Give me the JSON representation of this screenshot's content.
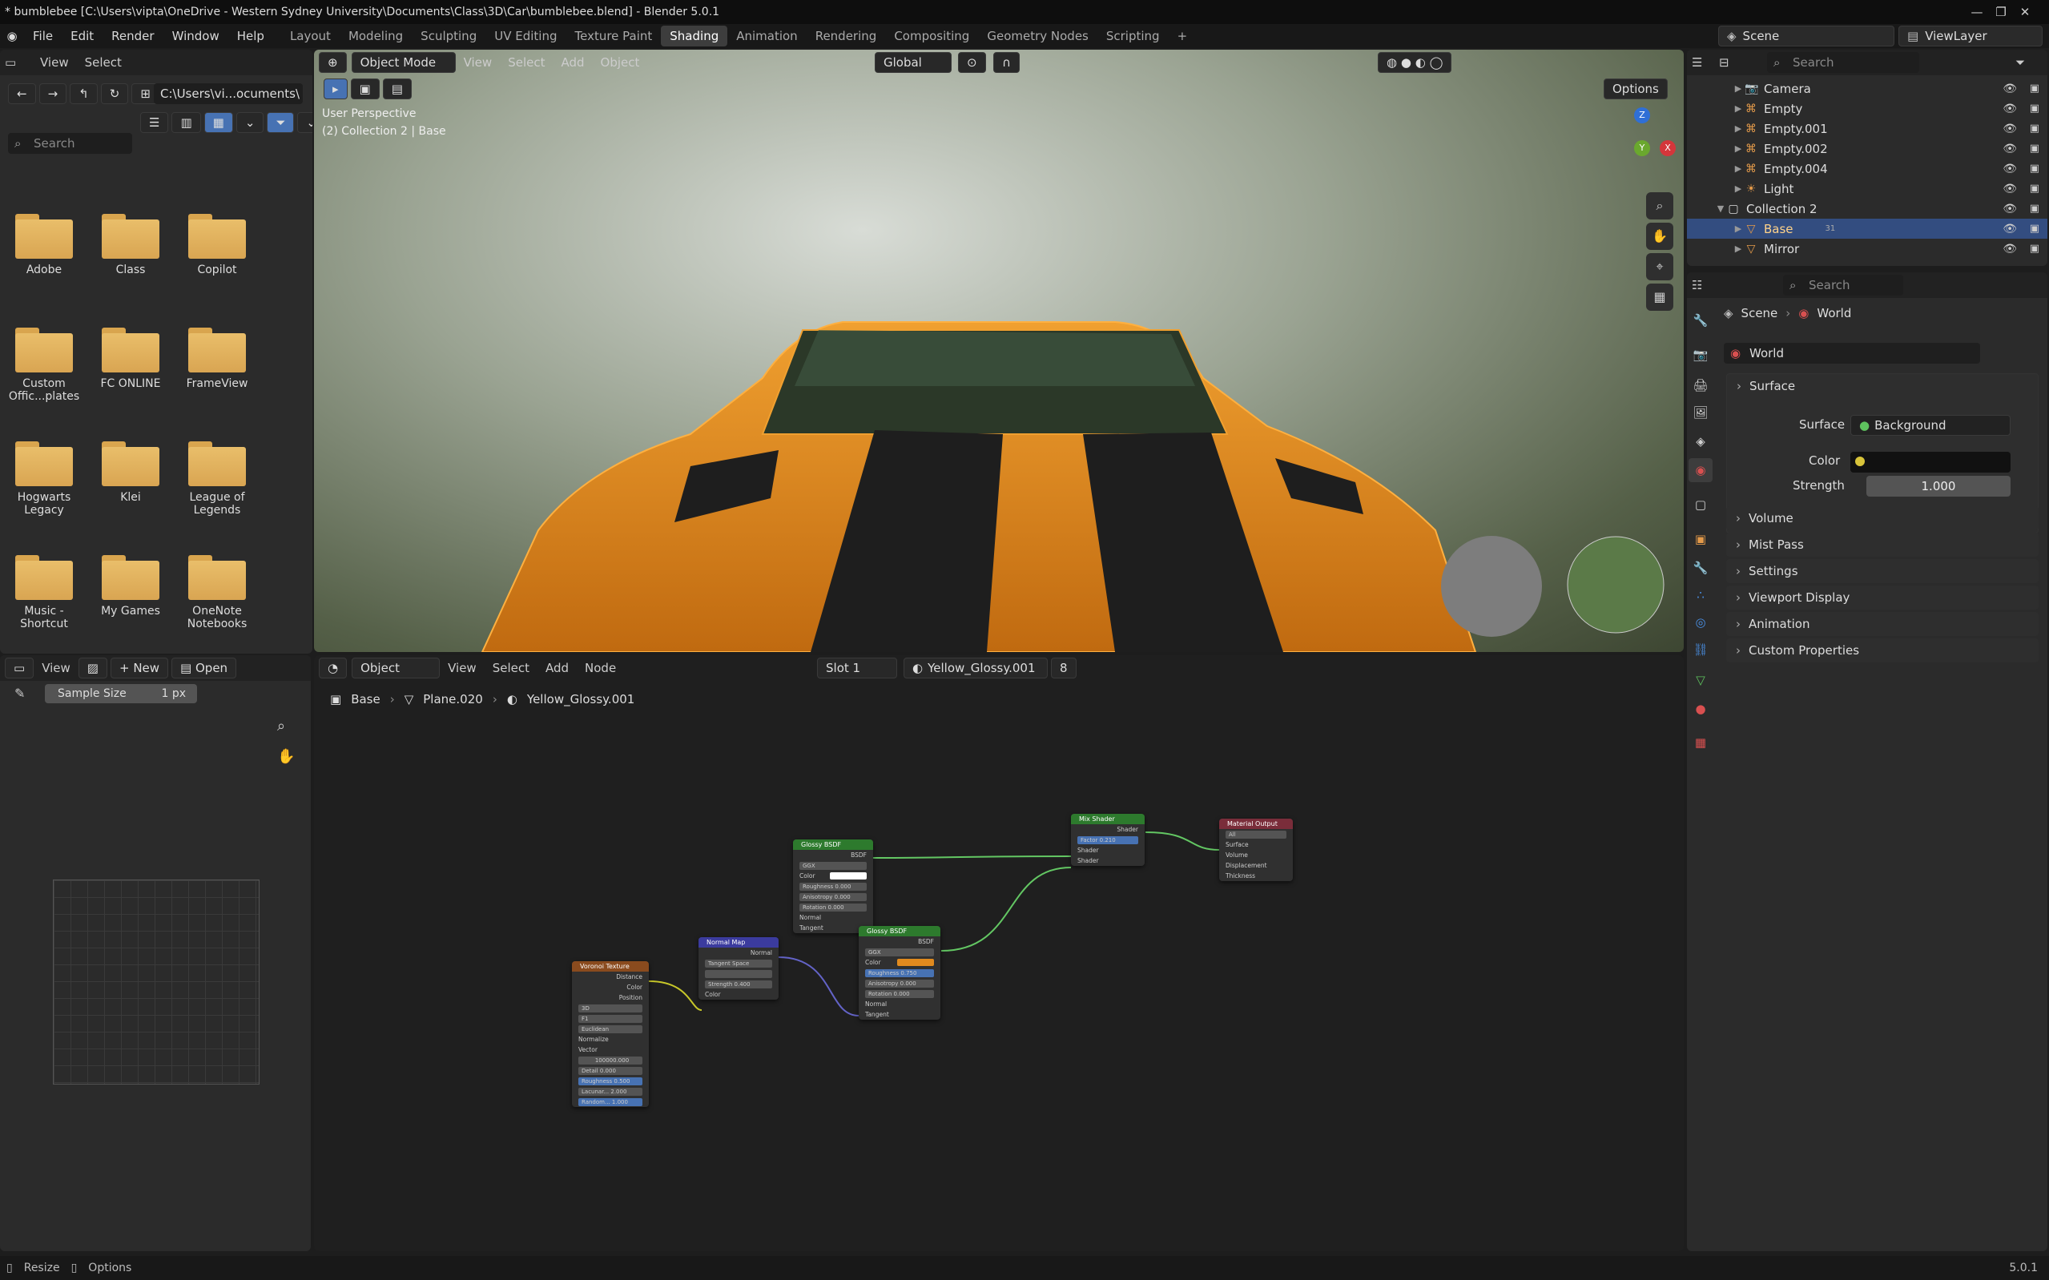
{
  "window": {
    "title": "* bumblebee [C:\\Users\\vipta\\OneDrive - Western Sydney University\\Documents\\Class\\3D\\Car\\bumblebee.blend] - Blender 5.0.1",
    "min": "—",
    "max": "❐",
    "close": "✕"
  },
  "menu": {
    "items": [
      "File",
      "Edit",
      "Render",
      "Window",
      "Help"
    ],
    "workspaces": [
      "Layout",
      "Modeling",
      "Sculpting",
      "UV Editing",
      "Texture Paint",
      "Shading",
      "Animation",
      "Rendering",
      "Compositing",
      "Geometry Nodes",
      "Scripting"
    ],
    "active_workspace": "Shading",
    "add_tab": "+",
    "scene": "Scene",
    "view_layer": "ViewLayer"
  },
  "file_browser": {
    "menus": [
      "View",
      "Select"
    ],
    "path": "C:\\Users\\vi...ocuments\\",
    "search_placeholder": "Search",
    "folders": [
      "Adobe",
      "Class",
      "Copilot",
      "Custom Offic...plates",
      "FC ONLINE",
      "FrameView",
      "Hogwarts Legacy",
      "Klei",
      "League of Legends",
      "Music - Shortcut",
      "My Games",
      "OneNote Notebooks"
    ]
  },
  "viewport": {
    "mode": "Object Mode",
    "menus": [
      "View",
      "Select",
      "Add",
      "Object"
    ],
    "orientation": "Global",
    "options": "Options",
    "overlay_title": "User Perspective",
    "overlay_sub": "(2) Collection 2 | Base",
    "gizmo": {
      "z": "Z",
      "y": "Y",
      "x": "X"
    }
  },
  "outliner": {
    "search_placeholder": "Search",
    "items": [
      {
        "name": "Camera",
        "icon": "camera-icon"
      },
      {
        "name": "Empty",
        "icon": "empty-icon"
      },
      {
        "name": "Empty.001",
        "icon": "empty-icon"
      },
      {
        "name": "Empty.002",
        "icon": "empty-icon"
      },
      {
        "name": "Empty.004",
        "icon": "empty-icon"
      },
      {
        "name": "Light",
        "icon": "light-icon"
      }
    ],
    "collection": "Collection 2",
    "children": [
      {
        "name": "Base",
        "icon": "mesh-icon",
        "selected": true,
        "badge": "31"
      },
      {
        "name": "Mirror",
        "icon": "mesh-icon",
        "selected": false
      }
    ]
  },
  "properties": {
    "search_placeholder": "Search",
    "breadcrumb": [
      "Scene",
      "World"
    ],
    "world_name": "World",
    "surface_panel": "Surface",
    "surface_label": "Surface",
    "surface_value": "Background",
    "color_label": "Color",
    "strength_label": "Strength",
    "strength_value": "1.000",
    "panels": [
      "Volume",
      "Mist Pass",
      "Settings",
      "Viewport Display",
      "Animation",
      "Custom Properties"
    ]
  },
  "image_editor": {
    "view": "View",
    "new": "New",
    "open": "Open",
    "sample_label": "Sample Size",
    "sample_value": "1 px"
  },
  "node_editor": {
    "object_mode": "Object",
    "menus": [
      "View",
      "Select",
      "Add",
      "Node"
    ],
    "slot": "Slot 1",
    "material": "Yellow_Glossy.001",
    "users": "8",
    "breadcrumb": [
      "Base",
      "Plane.020",
      "Yellow_Glossy.001"
    ]
  },
  "nodes": {
    "glossy1": {
      "title": "Glossy BSDF",
      "out": "BSDF",
      "dist": "GGX",
      "color": "Color",
      "rough": "Roughness",
      "rough_v": "0.000",
      "aniso": "Anisotropy",
      "aniso_v": "0.000",
      "rot": "Rotation",
      "rot_v": "0.000",
      "normal": "Normal",
      "tangent": "Tangent"
    },
    "glossy2": {
      "title": "Glossy BSDF",
      "out": "BSDF",
      "dist": "GGX",
      "color": "Color",
      "rough": "Roughness",
      "rough_v": "0.750",
      "aniso": "Anisotropy",
      "aniso_v": "0.000",
      "rot": "Rotation",
      "rot_v": "0.000",
      "normal": "Normal",
      "tangent": "Tangent"
    },
    "mix": {
      "title": "Mix Shader",
      "out": "Shader",
      "fac": "Factor",
      "fac_v": "0.210",
      "s1": "Shader",
      "s2": "Shader"
    },
    "output": {
      "title": "Material Output",
      "target": "All",
      "surface": "Surface",
      "volume": "Volume",
      "disp": "Displacement",
      "thick": "Thickness"
    },
    "normalmap": {
      "title": "Normal Map",
      "out": "Normal",
      "space": "Tangent Space",
      "strength": "Strength",
      "strength_v": "0.400",
      "color": "Color"
    },
    "voronoi": {
      "title": "Voronoi Texture",
      "dist": "Distance",
      "color": "Color",
      "pos": "Position",
      "dim": "3D",
      "feat": "F1",
      "metric": "Euclidean",
      "normalize": "Normalize",
      "vector": "Vector",
      "scale_v": "100000.000",
      "detail": "Detail",
      "detail_v": "0.000",
      "rough": "Roughness",
      "rough_v": "0.500",
      "lac": "Lacunar...",
      "lac_v": "2.000",
      "rand": "Random...",
      "rand_v": "1.000"
    }
  },
  "status": {
    "resize": "Resize",
    "options": "Options",
    "version": "5.0.1"
  },
  "colors": {
    "accent": "#4772b3",
    "car": "#e08a1e",
    "glossy_header": "#2d7a2d",
    "mix_header": "#2d7a2d",
    "output_header": "#7a2d3a",
    "normal_header": "#3b3b9e",
    "voronoi_header": "#8a4b1e"
  }
}
